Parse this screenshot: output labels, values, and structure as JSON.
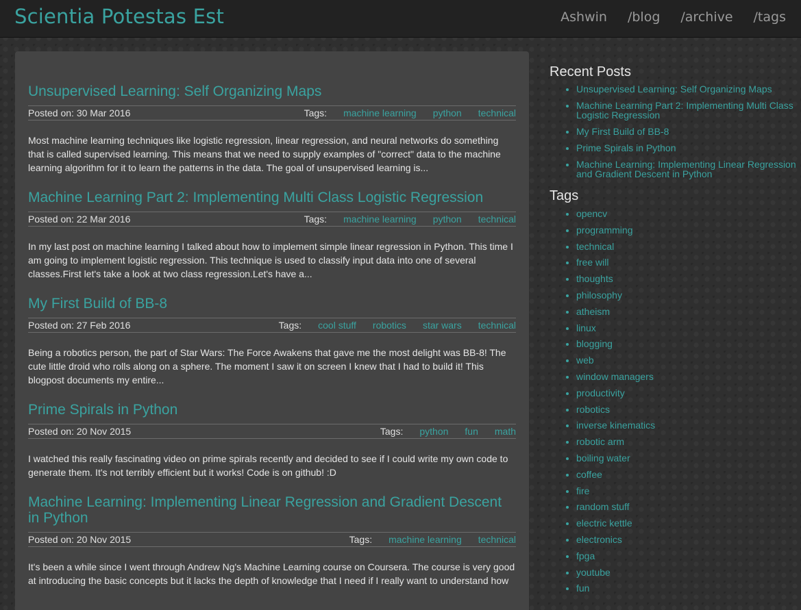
{
  "header": {
    "brand": "Scientia Potestas Est",
    "nav": [
      "Ashwin",
      "/blog",
      "/archive",
      "/tags"
    ]
  },
  "posts": [
    {
      "title": "Unsupervised Learning: Self Organizing Maps",
      "posted": "Posted on: 30 Mar 2016",
      "tags_label": "Tags:",
      "tags": [
        "machine learning",
        "python",
        "technical"
      ],
      "excerpt": "Most machine learning techniques like logistic regression, linear regression, and neural networks do something that is called supervised learning. This means that we need to supply examples of \"correct\" data to the machine learning algorithm for it to learn the patterns in the data. The goal of unsupervised learning is..."
    },
    {
      "title": "Machine Learning Part 2: Implementing Multi Class Logistic Regression",
      "posted": "Posted on: 22 Mar 2016",
      "tags_label": "Tags:",
      "tags": [
        "machine learning",
        "python",
        "technical"
      ],
      "excerpt": "In my last post on machine learning I talked about how to implement simple linear regression in Python. This time I am going to implement logistic regression. This technique is used to classify input data into one of several classes.First let's take a look at two class regression.Let's have a..."
    },
    {
      "title": "My First Build of BB-8",
      "posted": "Posted on: 27 Feb 2016",
      "tags_label": "Tags:",
      "tags": [
        "cool stuff",
        "robotics",
        "star wars",
        "technical"
      ],
      "excerpt": "Being a robotics person, the part of Star Wars: The Force Awakens that gave me the most delight was BB-8! The cute little droid who rolls along on a sphere. The moment I saw it on screen I knew that I had to build it! This blogpost documents my entire..."
    },
    {
      "title": "Prime Spirals in Python",
      "posted": "Posted on: 20 Nov 2015",
      "tags_label": "Tags:",
      "tags": [
        "python",
        "fun",
        "math"
      ],
      "excerpt": "I watched this really fascinating video on prime spirals recently and decided to see if I could write my own code to generate them. It's not terribly efficient but it works! Code is on github! :D"
    },
    {
      "title": "Machine Learning: Implementing Linear Regression and Gradient Descent in Python",
      "posted": "Posted on: 20 Nov 2015",
      "tags_label": "Tags:",
      "tags": [
        "machine learning",
        "technical"
      ],
      "excerpt": "It's been a while since I went through Andrew Ng's Machine Learning course on Coursera. The course is very good at introducing the basic concepts but it lacks the depth of knowledge that I need if I really want to understand how"
    }
  ],
  "sidebar": {
    "recent_title": "Recent Posts",
    "recent_posts": [
      "Unsupervised Learning: Self Organizing Maps",
      "Machine Learning Part 2: Implementing Multi Class Logistic Regression",
      "My First Build of BB-8",
      "Prime Spirals in Python",
      "Machine Learning: Implementing Linear Regression and Gradient Descent in Python"
    ],
    "tags_title": "Tags",
    "tags": [
      "opencv",
      "programming",
      "technical",
      "free will",
      "thoughts",
      "philosophy",
      "atheism",
      "linux",
      "blogging",
      "web",
      "window managers",
      "productivity",
      "robotics",
      "inverse kinematics",
      "robotic arm",
      "boiling water",
      "coffee",
      "fire",
      "random stuff",
      "electric kettle",
      "electronics",
      "fpga",
      "youtube",
      "fun"
    ]
  },
  "colors": {
    "accent": "#3aa3a0",
    "topbar": "#222222",
    "panel": "#444444"
  }
}
